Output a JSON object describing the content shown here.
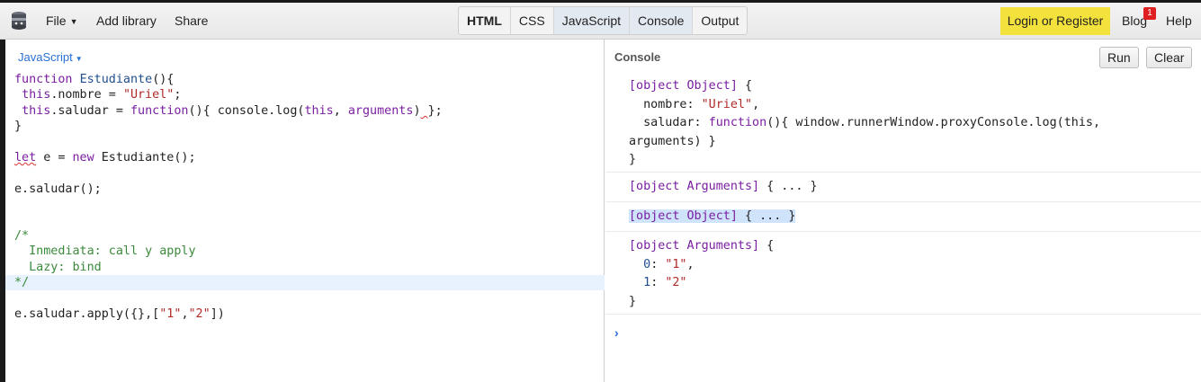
{
  "menu": {
    "file": "File",
    "add_library": "Add library",
    "share": "Share"
  },
  "tabs": [
    "HTML",
    "CSS",
    "JavaScript",
    "Console",
    "Output"
  ],
  "account": {
    "login": "Login or Register",
    "blog": "Blog",
    "blog_badge": "1",
    "help": "Help"
  },
  "editor": {
    "language": "JavaScript",
    "lines": [
      "function Estudiante(){",
      " this.nombre = \"Uriel\";",
      " this.saludar = function(){ console.log(this, arguments) };",
      "}",
      "",
      "let e = new Estudiante();",
      "",
      "e.saludar();",
      "",
      "",
      "/*",
      "  Inmediata: call y apply",
      "  Lazy: bind",
      "*/",
      "",
      "e.saludar.apply({},[\"1\",\"2\"])"
    ]
  },
  "console": {
    "title": "Console",
    "run": "Run",
    "clear": "Clear",
    "entries": [
      {
        "lines": [
          "[object Object] {",
          "  nombre: \"Uriel\",",
          "  saludar: function(){ window.runnerWindow.proxyConsole.log(this,",
          "arguments) }",
          "}"
        ]
      },
      {
        "lines": [
          "[object Arguments] { ... }"
        ]
      },
      {
        "lines": [
          "[object Object] { ... }"
        ],
        "selected": true
      },
      {
        "lines": [
          "[object Arguments] {",
          "  0: \"1\",",
          "  1: \"2\"",
          "}"
        ]
      }
    ],
    "prompt": "›"
  },
  "colors": {
    "login_bg": "#f4e23c",
    "link_blue": "#2a6fd6",
    "keyword_purple": "#7a1fa2",
    "string_red": "#b02a2a",
    "comment_green": "#3b8a3b",
    "active_line": "#e8f2ff",
    "selection": "#cfe3fb"
  }
}
